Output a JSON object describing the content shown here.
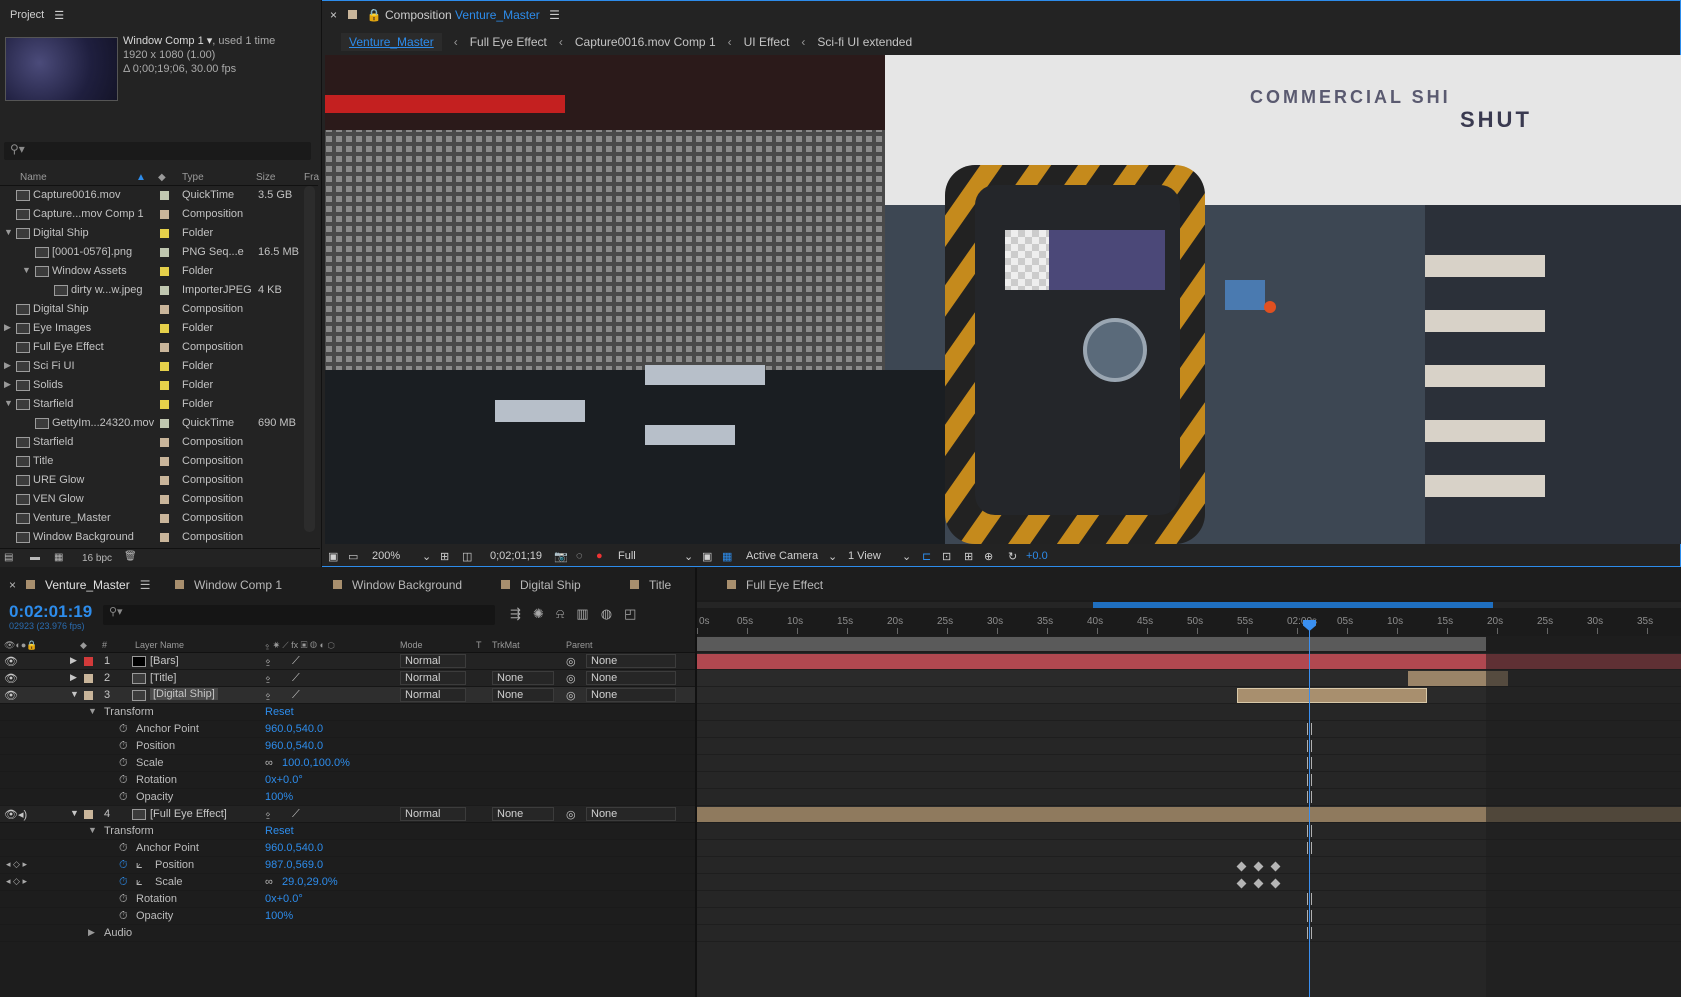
{
  "project": {
    "title": "Project",
    "comp_name": "Window Comp 1",
    "comp_used": ", used 1 time",
    "comp_res": "1920 x 1080 (1.00)",
    "comp_dur": "Δ 0;00;19;06, 30.00 fps",
    "search_placeholder": "",
    "columns": {
      "name": "Name",
      "type": "Type",
      "size": "Size",
      "fr": "Fra"
    },
    "items": [
      {
        "indent": 0,
        "tri": "",
        "name": "Capture0016.mov",
        "type": "QuickTime",
        "size": "3.5 GB",
        "color": "#c0c7b0"
      },
      {
        "indent": 0,
        "tri": "",
        "name": "Capture...mov Comp 1",
        "type": "Composition",
        "size": "",
        "color": "#c9b59a"
      },
      {
        "indent": 0,
        "tri": "▼",
        "name": "Digital Ship",
        "type": "Folder",
        "size": "",
        "color": "#e5d04a"
      },
      {
        "indent": 1,
        "tri": "",
        "name": "[0001-0576].png",
        "type": "PNG Seq...e",
        "size": "16.5 MB",
        "color": "#c0c7b0"
      },
      {
        "indent": 1,
        "tri": "▼",
        "name": "Window Assets",
        "type": "Folder",
        "size": "",
        "color": "#e5d04a"
      },
      {
        "indent": 2,
        "tri": "",
        "name": "dirty w...w.jpeg",
        "type": "ImporterJPEG",
        "size": "4 KB",
        "color": "#c0c7b0"
      },
      {
        "indent": 0,
        "tri": "",
        "name": "Digital Ship",
        "type": "Composition",
        "size": "",
        "color": "#c9b59a"
      },
      {
        "indent": 0,
        "tri": "▶",
        "name": "Eye Images",
        "type": "Folder",
        "size": "",
        "color": "#e5d04a"
      },
      {
        "indent": 0,
        "tri": "",
        "name": "Full Eye Effect",
        "type": "Composition",
        "size": "",
        "color": "#c9b59a"
      },
      {
        "indent": 0,
        "tri": "▶",
        "name": "Sci Fi UI",
        "type": "Folder",
        "size": "",
        "color": "#e5d04a"
      },
      {
        "indent": 0,
        "tri": "▶",
        "name": "Solids",
        "type": "Folder",
        "size": "",
        "color": "#e5d04a"
      },
      {
        "indent": 0,
        "tri": "▼",
        "name": "Starfield",
        "type": "Folder",
        "size": "",
        "color": "#e5d04a"
      },
      {
        "indent": 1,
        "tri": "",
        "name": "GettyIm...24320.mov",
        "type": "QuickTime",
        "size": "690 MB",
        "color": "#c0c7b0"
      },
      {
        "indent": 0,
        "tri": "",
        "name": "Starfield",
        "type": "Composition",
        "size": "",
        "color": "#c9b59a"
      },
      {
        "indent": 0,
        "tri": "",
        "name": "Title",
        "type": "Composition",
        "size": "",
        "color": "#c9b59a"
      },
      {
        "indent": 0,
        "tri": "",
        "name": "URE Glow",
        "type": "Composition",
        "size": "",
        "color": "#c9b59a"
      },
      {
        "indent": 0,
        "tri": "",
        "name": "VEN Glow",
        "type": "Composition",
        "size": "",
        "color": "#c9b59a"
      },
      {
        "indent": 0,
        "tri": "",
        "name": "Venture_Master",
        "type": "Composition",
        "size": "",
        "color": "#c9b59a"
      },
      {
        "indent": 0,
        "tri": "",
        "name": "Window Background",
        "type": "Composition",
        "size": "",
        "color": "#c9b59a"
      }
    ],
    "bpc": "16 bpc"
  },
  "composition": {
    "label": "Composition",
    "name": "Venture_Master",
    "breadcrumbs": [
      "Venture_Master",
      "Full Eye Effect",
      "Capture0016.mov Comp 1",
      "UI Effect",
      "Sci-fi UI extended"
    ],
    "viewer_text_1": "COMMERCIAL SHI",
    "viewer_text_2": "SHUT",
    "zoom": "200%",
    "timecode": "0;02;01;19",
    "resolution": "Full",
    "camera": "Active Camera",
    "views": "1 View",
    "exposure": "+0.0"
  },
  "timeline": {
    "tabs": [
      {
        "label": "Venture_Master",
        "color": "#a88f6e"
      },
      {
        "label": "Window Comp 1",
        "color": "#a88f6e"
      },
      {
        "label": "Window Background",
        "color": "#a88f6e"
      },
      {
        "label": "Digital Ship",
        "color": "#a88f6e"
      },
      {
        "label": "Title",
        "color": "#a88f6e"
      },
      {
        "label": "Full Eye Effect",
        "color": "#a88f6e"
      }
    ],
    "timecode": "0:02:01:19",
    "fps": "02923 (23.976 fps)",
    "columns": {
      "layer_name": "Layer Name",
      "mode": "Mode",
      "t": "T",
      "trkmat": "TrkMat",
      "parent": "Parent",
      "num": "#"
    },
    "ruler_ticks": [
      "0s",
      "05s",
      "10s",
      "15s",
      "20s",
      "25s",
      "30s",
      "35s",
      "40s",
      "45s",
      "50s",
      "55s",
      "02:00s",
      "05s",
      "10s",
      "15s",
      "20s",
      "25s",
      "30s",
      "35s"
    ],
    "layers": [
      {
        "num": "1",
        "name": "[Bars]",
        "mode": "Normal",
        "trkmat": "",
        "parent": "None",
        "color": "#d23a3a"
      },
      {
        "num": "2",
        "name": "[Title]",
        "mode": "Normal",
        "trkmat": "None",
        "parent": "None",
        "color": "#c9b59a"
      },
      {
        "num": "3",
        "name": "[Digital Ship]",
        "mode": "Normal",
        "trkmat": "None",
        "parent": "None",
        "color": "#c9b59a"
      },
      {
        "num": "4",
        "name": "[Full Eye Effect]",
        "mode": "Normal",
        "trkmat": "None",
        "parent": "None",
        "color": "#c9b59a"
      }
    ],
    "transform_label": "Transform",
    "reset_label": "Reset",
    "audio_label": "Audio",
    "props3": [
      {
        "name": "Anchor Point",
        "value": "960.0,540.0"
      },
      {
        "name": "Position",
        "value": "960.0,540.0"
      },
      {
        "name": "Scale",
        "value": "100.0,100.0%"
      },
      {
        "name": "Rotation",
        "value": "0x+0.0°"
      },
      {
        "name": "Opacity",
        "value": "100%"
      }
    ],
    "props4": [
      {
        "name": "Anchor Point",
        "value": "960.0,540.0"
      },
      {
        "name": "Position",
        "value": "987.0,569.0"
      },
      {
        "name": "Scale",
        "value": "29.0,29.0%"
      },
      {
        "name": "Rotation",
        "value": "0x+0.0°"
      },
      {
        "name": "Opacity",
        "value": "100%"
      }
    ]
  }
}
